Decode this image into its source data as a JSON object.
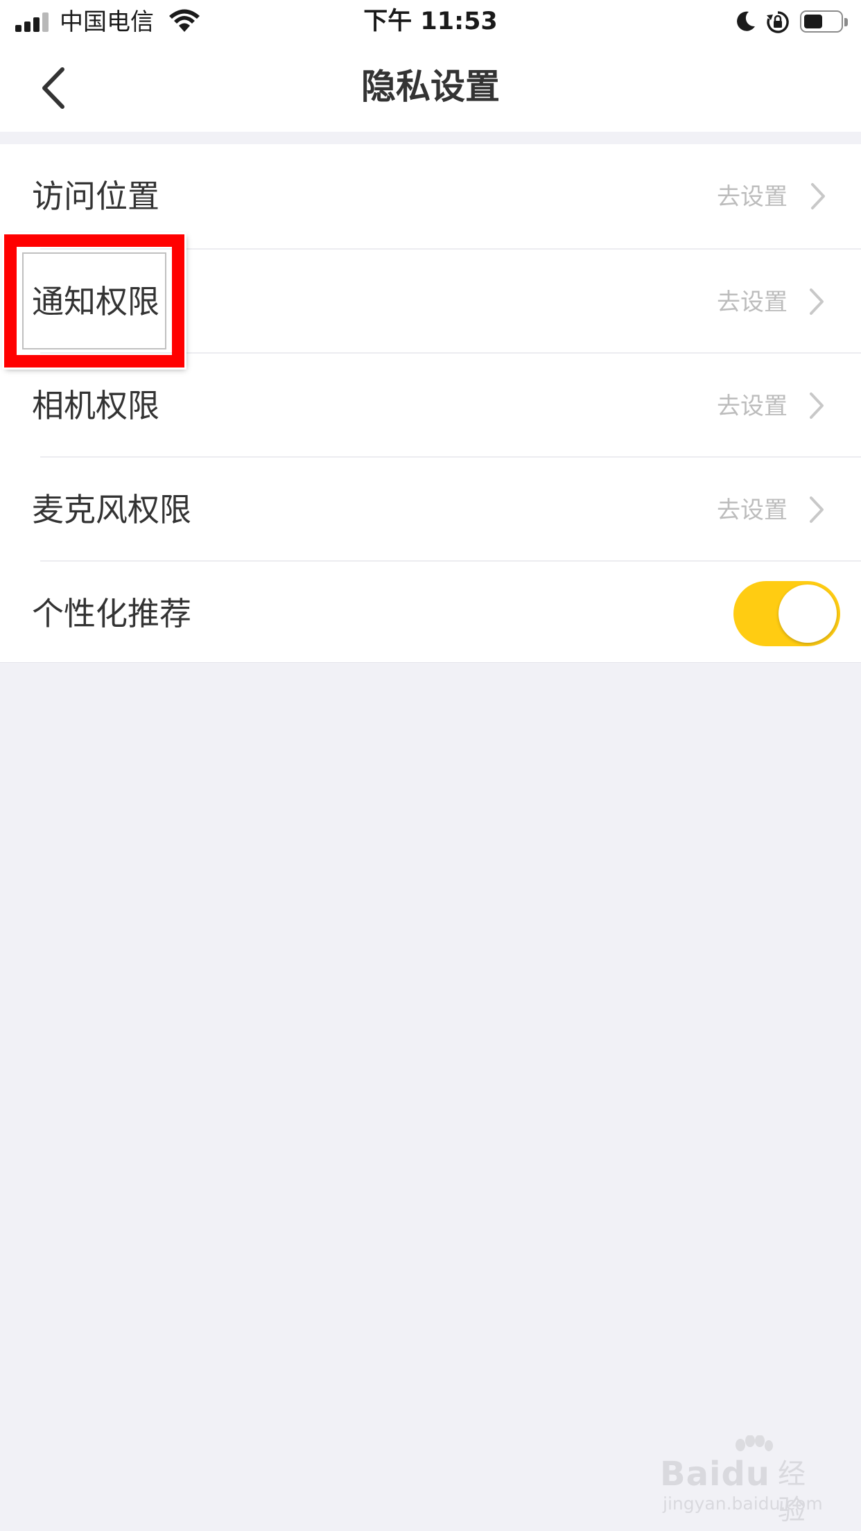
{
  "status_bar": {
    "carrier": "中国电信",
    "time": "下午 11:53"
  },
  "nav": {
    "title": "隐私设置"
  },
  "settings": {
    "items": [
      {
        "label": "访问位置",
        "value": "去设置"
      },
      {
        "label": "通知权限",
        "value": "去设置"
      },
      {
        "label": "相机权限",
        "value": "去设置"
      },
      {
        "label": "麦克风权限",
        "value": "去设置"
      },
      {
        "label": "个性化推荐",
        "toggle_on": true
      }
    ]
  },
  "colors": {
    "toggle_on": "#ffcc12",
    "highlight_box": "#ff0000",
    "page_background": "#f1f1f6"
  },
  "watermark": {
    "brand": "Bai",
    "brand_suffix": "du",
    "product": "经验",
    "url": "jingyan.baidu.com"
  },
  "icons": [
    "signal-icon",
    "wifi-icon",
    "moon-icon",
    "rotation-lock-icon",
    "battery-icon",
    "back-arrow-icon",
    "chevron-right-icon"
  ]
}
